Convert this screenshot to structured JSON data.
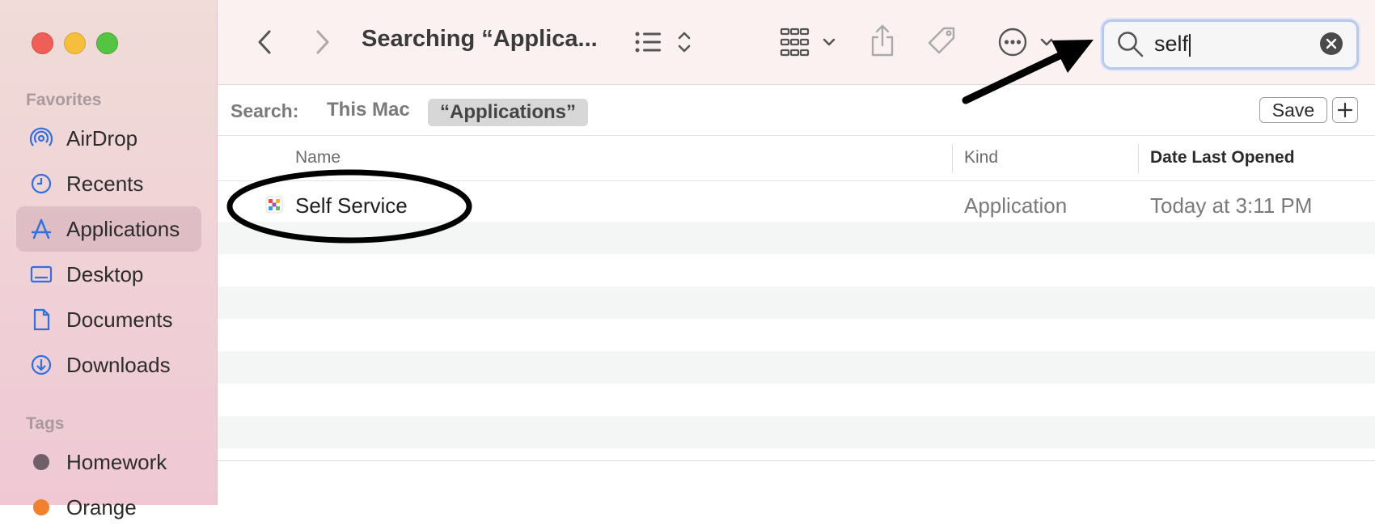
{
  "window": {
    "title": "Searching “Applica..."
  },
  "sidebar": {
    "favorites_title": "Favorites",
    "items": [
      {
        "label": "AirDrop",
        "icon": "airdrop-icon"
      },
      {
        "label": "Recents",
        "icon": "clock-icon"
      },
      {
        "label": "Applications",
        "icon": "applications-icon",
        "selected": true
      },
      {
        "label": "Desktop",
        "icon": "desktop-icon"
      },
      {
        "label": "Documents",
        "icon": "document-icon"
      },
      {
        "label": "Downloads",
        "icon": "download-icon"
      }
    ],
    "tags_title": "Tags",
    "tags": [
      {
        "label": "Homework",
        "color": "#6e5f68"
      },
      {
        "label": "Orange",
        "color": "#f0812e"
      }
    ]
  },
  "toolbar": {
    "icons": [
      "back-chevron-icon",
      "forward-chevron-icon",
      "list-view-icon",
      "icon-grid-icon",
      "share-icon",
      "tag-icon",
      "more-actions-icon"
    ]
  },
  "search": {
    "value": "self",
    "icon": "magnifier-icon"
  },
  "scope": {
    "label": "Search:",
    "options": [
      "This Mac",
      "“Applications”"
    ],
    "active_index": 1,
    "save_label": "Save",
    "add_label": "+"
  },
  "table": {
    "columns": [
      "Name",
      "Kind",
      "Date Last Opened"
    ],
    "rows": [
      {
        "name": "Self Service",
        "kind": "Application",
        "date": "Today at 3:11 PM",
        "icon": "self-service-app-icon"
      }
    ]
  },
  "colors": {
    "accent": "#2f6fe0",
    "selection": "#d7d7d7"
  }
}
